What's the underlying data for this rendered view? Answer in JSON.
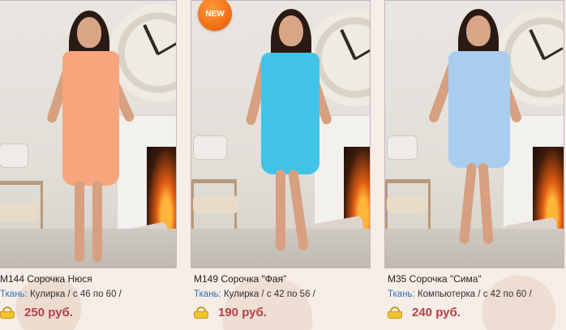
{
  "products": [
    {
      "title": "М144 Сорочка Нюся",
      "fabric_label": "Ткань:",
      "fabric_value": " Кулирка / с 46 по 60 /",
      "price": "250 руб.",
      "dress_color": "#f7a57d",
      "is_new": false
    },
    {
      "title": "М149 Сорочка \"Фая\"",
      "fabric_label": "Ткань:",
      "fabric_value": " Кулирка / с 42 по 56 /",
      "price": "190 руб.",
      "dress_color": "#41c3e8",
      "is_new": true,
      "badge": "NEW"
    },
    {
      "title": "М35 Сорочка \"Сима\"",
      "fabric_label": "Ткань:",
      "fabric_value": " Компьютерка / с 42 по 60 /",
      "price": "240 руб.",
      "dress_color": "#a9cdef",
      "is_new": false
    }
  ],
  "icons": {
    "cart": "basket-icon"
  },
  "colors": {
    "price": "#b6404a",
    "fabric_label": "#2b6fb4",
    "badge": "#f07a1a"
  }
}
